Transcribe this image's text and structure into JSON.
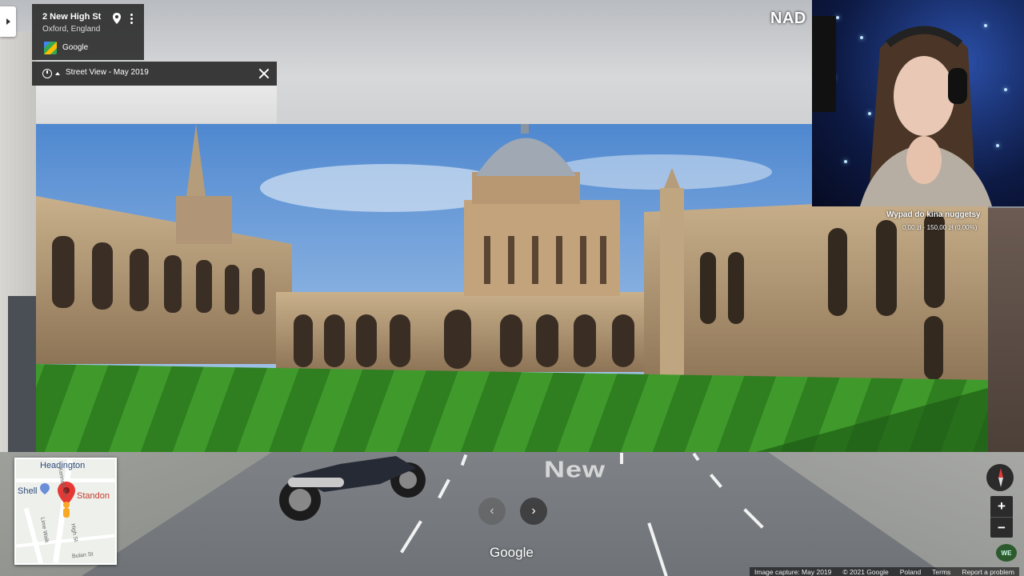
{
  "location": {
    "address": "2 New High St",
    "city": "Oxford, England",
    "provider": "Google"
  },
  "street_view": {
    "label": "Street View - May 2019"
  },
  "road_text": "New",
  "overlay": {
    "title": "NAD",
    "donation_title": "Wypad do kina nuggetsy",
    "donation_amount": "0,00 zł · 150,00 zł (0,00%)"
  },
  "minimap": {
    "labels": {
      "headington": "Headington",
      "shell": "Shell",
      "standon": "Standon",
      "street1": "Kenneth Rd",
      "street2": "Lime Walk",
      "street3": "High St",
      "street4": "Bulan St"
    }
  },
  "controls": {
    "zoom_in": "+",
    "zoom_out": "−",
    "badge": "WE"
  },
  "google_wordmark": "Google",
  "footer": {
    "image_capture": "Image capture: May 2019",
    "copyright": "© 2021 Google",
    "country": "Poland",
    "terms": "Terms",
    "report": "Report a problem"
  },
  "colors": {
    "card_bg": "#282828",
    "pin_red": "#e53935",
    "lawn": "#3d8a2a",
    "sky": "#5d93d6",
    "stone": "#b79e7c"
  }
}
